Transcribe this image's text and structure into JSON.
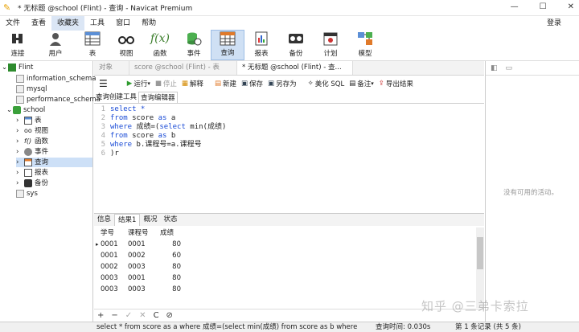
{
  "window": {
    "title": "* 无标题 @school (Flint) - 查询 - Navicat Premium"
  },
  "menu": {
    "items": [
      "文件",
      "查看",
      "收藏夹",
      "工具",
      "窗口",
      "帮助"
    ],
    "login": "登录"
  },
  "toolbar": {
    "items": [
      "连接",
      "用户",
      "表",
      "视图",
      "函数",
      "事件",
      "查询",
      "报表",
      "备份",
      "计划",
      "模型"
    ]
  },
  "tree": {
    "connection": "Flint",
    "databases": [
      "information_schema",
      "mysql",
      "performance_schema",
      "school"
    ],
    "school_children": [
      "表",
      "视图",
      "函数",
      "事件",
      "查询",
      "报表",
      "备份"
    ],
    "extra_db": "sys"
  },
  "tabs": [
    "对象",
    "score @school (Flint) - 表",
    "* 无标题 @school (Flint) - 查..."
  ],
  "query_toolbar": {
    "run": "运行",
    "stop": "停止",
    "explain": "解释",
    "new": "新建",
    "save": "保存",
    "save_as": "另存为",
    "beautify": "美化 SQL",
    "note": "备注",
    "export": "导出结果"
  },
  "subtabs": [
    "查询创建工具",
    "查询编辑器"
  ],
  "editor": {
    "lines": [
      {
        "n": "1",
        "parts": [
          {
            "t": "select *",
            "k": true
          }
        ]
      },
      {
        "n": "2",
        "parts": [
          {
            "t": "from",
            "k": true
          },
          {
            "t": " score ",
            "k": false
          },
          {
            "t": "as",
            "k": true
          },
          {
            "t": " a",
            "k": false
          }
        ]
      },
      {
        "n": "3",
        "parts": [
          {
            "t": "where",
            "k": true
          },
          {
            "t": " 成绩=(",
            "k": false
          },
          {
            "t": "select",
            "k": true
          },
          {
            "t": " min(成绩)",
            "k": false
          }
        ]
      },
      {
        "n": "4",
        "parts": [
          {
            "t": "from",
            "k": true
          },
          {
            "t": " score ",
            "k": false
          },
          {
            "t": "as",
            "k": true
          },
          {
            "t": " b",
            "k": false
          }
        ]
      },
      {
        "n": "5",
        "parts": [
          {
            "t": "where",
            "k": true
          },
          {
            "t": " b.课程号=a.课程号",
            "k": false
          }
        ]
      },
      {
        "n": "6",
        "parts": [
          {
            "t": ")r",
            "k": false
          }
        ]
      }
    ]
  },
  "right_pane": {
    "note": "没有可用的活动。"
  },
  "result_tabs": [
    "信息",
    "结果1",
    "概况",
    "状态"
  ],
  "results": {
    "columns": [
      "学号",
      "课程号",
      "成绩"
    ],
    "rows": [
      [
        "0001",
        "0001",
        "80"
      ],
      [
        "0001",
        "0002",
        "60"
      ],
      [
        "0002",
        "0003",
        "80"
      ],
      [
        "0003",
        "0001",
        "80"
      ],
      [
        "0003",
        "0003",
        "80"
      ]
    ]
  },
  "bottom_controls": [
    "+",
    "−",
    "✓",
    "✕",
    "C",
    "⊘"
  ],
  "status": {
    "sql": "select * from score as a where 成绩=(select min(成绩) from score as b where",
    "time": "查询时间: 0.030s",
    "records": "第 1 条记录 (共 5 条)"
  },
  "watermark": "知乎 @三弟卡索拉"
}
